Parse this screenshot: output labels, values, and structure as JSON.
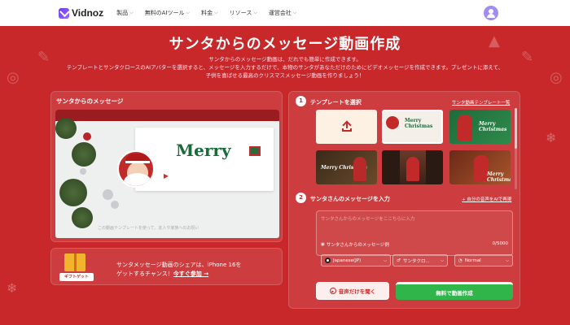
{
  "nav": {
    "logo": "Vidnoz",
    "items": [
      {
        "label": "製品"
      },
      {
        "label": "無料のAIツール"
      },
      {
        "label": "料金"
      },
      {
        "label": "リソース"
      },
      {
        "label": "運営会社"
      }
    ]
  },
  "hero": {
    "title": "サンタからのメッセージ動画作成",
    "subtitle_line1": "サンタからのメッセージ動画は、だれでも簡単に作成できます。",
    "subtitle_line2": "テンプレートとサンタクロースのAIアバターを選択すると、メッセージを入力するだけで、本物のサンタがあなただけのためにビデオメッセージを作成できます。プレゼントに添えて、",
    "subtitle_line3": "子供を喜ばせる最高のクリスマスメッセージ動画を作りましょう！"
  },
  "left_panel": {
    "title": "サンタからのメッセージ",
    "card_text": "Merry",
    "caption": "この動画テンプレートを使って、友人や家族へのお祝い"
  },
  "promo": {
    "gift_tag": "ギフトゲット",
    "text_line1": "サンタメッセージ動画のシェアは、iPhone 16を",
    "text_line2": "ゲットするチャンス！",
    "link": "今すぐ参加 →"
  },
  "right_panel": {
    "step1_number": "1",
    "step1_title": "テンプレートを選択",
    "step1_link": "サンタ動画テンプレート一覧",
    "templates": [
      {
        "text": ""
      },
      {
        "text": "Merry Christmas"
      },
      {
        "text": "Merry Christmas"
      },
      {
        "text": "Merry Christmas"
      },
      {
        "text": ""
      },
      {
        "text": "Merry Christmas"
      }
    ],
    "step2_number": "2",
    "step2_title": "サンタさんのメッセージを入力",
    "step2_link": "+ 自分の音声をAIで再現",
    "message_placeholder": "サンタさんからのメッセージをここちらに入力",
    "message_example": "サンタさんからのメッセージ例",
    "message_count": "0/5000",
    "language": "Japanese(JP)",
    "voice": "サンタクロ...",
    "speed": "Normal",
    "listen_button": "音声だけを聞く",
    "create_button": "無料で動画作成"
  },
  "colors": {
    "background": "#c8282a",
    "primary_button": "#2fb54a",
    "accent": "#6a3df0"
  }
}
